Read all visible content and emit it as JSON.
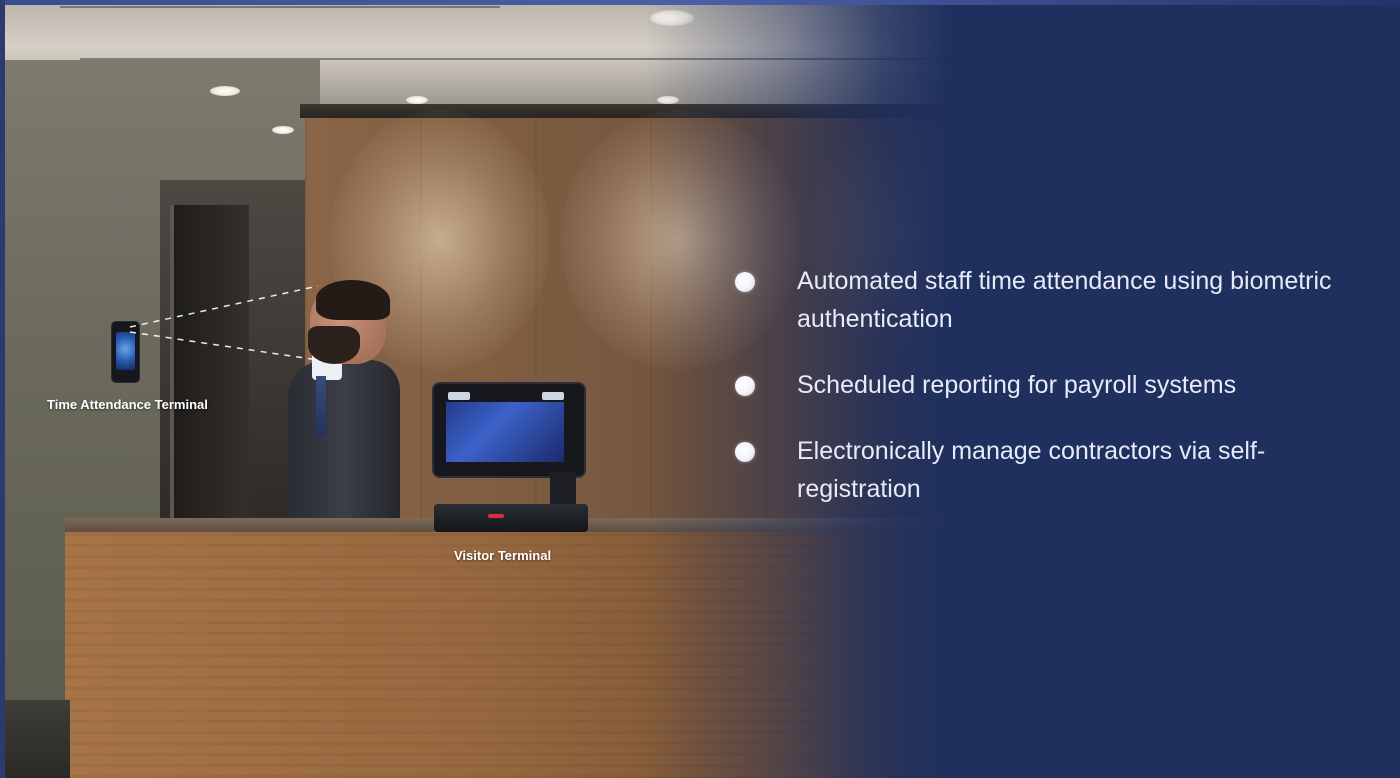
{
  "scene": {
    "attendance_label": "Time Attendance Terminal",
    "visitor_label": "Visitor Terminal"
  },
  "features": {
    "items": [
      {
        "text": "Automated staff time attendance using biometric authentication",
        "icon": "bullet-dot-icon"
      },
      {
        "text": "Scheduled reporting for payroll systems",
        "icon": "bullet-dot-icon"
      },
      {
        "text": "Electronically manage contractors via self-registration",
        "icon": "bullet-dot-icon"
      }
    ]
  },
  "theme": {
    "background": "#1f2f5e",
    "text": "#e6ebf7",
    "label": "#ffffff"
  }
}
